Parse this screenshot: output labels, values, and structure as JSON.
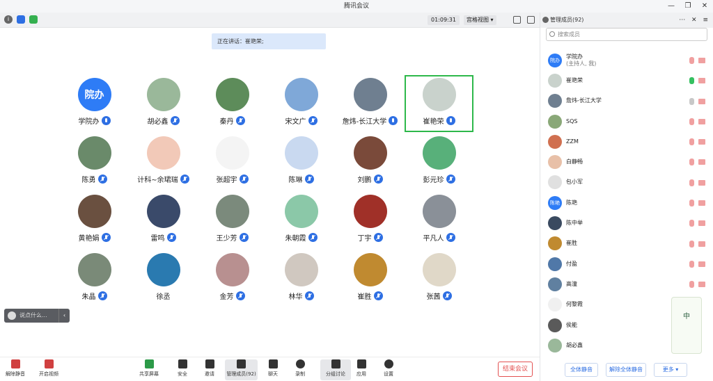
{
  "window": {
    "title": "腾讯会议",
    "controls": [
      "—",
      "❐",
      "✕"
    ]
  },
  "topbar": {
    "timer": "01:09:31",
    "view_label": "宫格视图 ▾"
  },
  "speaking": "正在讲话：崔艳荣;",
  "participants_grid": [
    {
      "name": "学院办",
      "mic": "on",
      "avatar_text": "院办",
      "color": "#2e7cf6"
    },
    {
      "name": "胡必鑫",
      "mic": "off",
      "color": "#9ab89a"
    },
    {
      "name": "秦丹",
      "mic": "off",
      "color": "#5d8c5a"
    },
    {
      "name": "宋文广",
      "mic": "off",
      "color": "#7fa8d8"
    },
    {
      "name": "詹炜-长江大学",
      "mic": "on",
      "color": "#6f7f90"
    },
    {
      "name": "崔艳荣",
      "mic": "on",
      "color": "#c9d2cc"
    },
    {
      "name": "陈勇",
      "mic": "off",
      "color": "#6a8a6a"
    },
    {
      "name": "计科~余珺瑞",
      "mic": "off",
      "color": "#f2c9b8"
    },
    {
      "name": "张超宇",
      "mic": "off",
      "color": "#f4f4f4"
    },
    {
      "name": "陈琳",
      "mic": "off",
      "color": "#c9d9f0"
    },
    {
      "name": "刘鹏",
      "mic": "off",
      "color": "#7a4a3a"
    },
    {
      "name": "彭元珍",
      "mic": "off",
      "color": "#58b07a"
    },
    {
      "name": "黄艳娟",
      "mic": "off",
      "color": "#6a5040"
    },
    {
      "name": "雷鸣",
      "mic": "off",
      "color": "#3a4a6a"
    },
    {
      "name": "王少芳",
      "mic": "off",
      "color": "#7b8a7c"
    },
    {
      "name": "朱朝霞",
      "mic": "off",
      "color": "#8bc8a8"
    },
    {
      "name": "丁宇",
      "mic": "off",
      "color": "#a03028"
    },
    {
      "name": "平凡人",
      "mic": "off",
      "color": "#8a9098"
    },
    {
      "name": "朱晶",
      "mic": "off",
      "color": "#7a8a78"
    },
    {
      "name": "徐丞",
      "mic": "none",
      "color": "#2a7ab0"
    },
    {
      "name": "金芳",
      "mic": "off",
      "color": "#b89090"
    },
    {
      "name": "林华",
      "mic": "off",
      "color": "#d0c8c0"
    },
    {
      "name": "崔胜",
      "mic": "off",
      "color": "#c08a30"
    },
    {
      "name": "张茜",
      "mic": "off",
      "color": "#e0d8c8"
    }
  ],
  "chat": {
    "placeholder": "说点什么...",
    "collapse": "‹"
  },
  "toolbar": {
    "unmute": "解除静音",
    "start_video": "开启视频",
    "share_screen": "共享屏幕",
    "security": "安全",
    "invite": "邀请",
    "members": "管理成员(92)",
    "chat": "聊天",
    "record": "录制",
    "breakout": "分组讨论",
    "apps": "应用",
    "settings": "设置",
    "end": "结束会议"
  },
  "panel": {
    "title": "管理成员(92)",
    "header_controls": "⋯ ✕ ≡",
    "search_placeholder": "搜索成员",
    "members": [
      {
        "name": "学院办",
        "sub": "(主持人, 我)",
        "avatar_text": "院办",
        "color": "#2e7cf6",
        "mic": "muted"
      },
      {
        "name": "崔艳荣",
        "color": "#c9d2cc",
        "mic": "on"
      },
      {
        "name": "詹炜-长江大学",
        "color": "#6f7f90",
        "mic": "gray"
      },
      {
        "name": "SQS",
        "color": "#8aa878",
        "mic": "muted"
      },
      {
        "name": "ZZM",
        "color": "#d07050",
        "mic": "muted"
      },
      {
        "name": "白静畅",
        "color": "#e8c0a8",
        "mic": "muted"
      },
      {
        "name": "包小军",
        "color": "#e0e0e0",
        "mic": "muted"
      },
      {
        "name": "陈艳",
        "avatar_text": "陈艳",
        "color": "#2e7cf6",
        "mic": "muted"
      },
      {
        "name": "陈中举",
        "color": "#3a4a60",
        "mic": "muted"
      },
      {
        "name": "崔胜",
        "color": "#c08a30",
        "mic": "muted"
      },
      {
        "name": "付盈",
        "color": "#5078a8",
        "mic": "muted"
      },
      {
        "name": "高潼",
        "color": "#6080a0",
        "mic": "muted"
      },
      {
        "name": "何黎霞",
        "color": "#f0f0f0",
        "mic": "none"
      },
      {
        "name": "侯能",
        "color": "#5a5a5a",
        "mic": "none"
      },
      {
        "name": "胡必鑫",
        "color": "#9ab89a",
        "mic": "none"
      }
    ],
    "mute_all": "全体静音",
    "unmute_all": "解除全体静音",
    "more": "更多 ▾"
  },
  "decoration": {
    "flower_text": "中"
  }
}
